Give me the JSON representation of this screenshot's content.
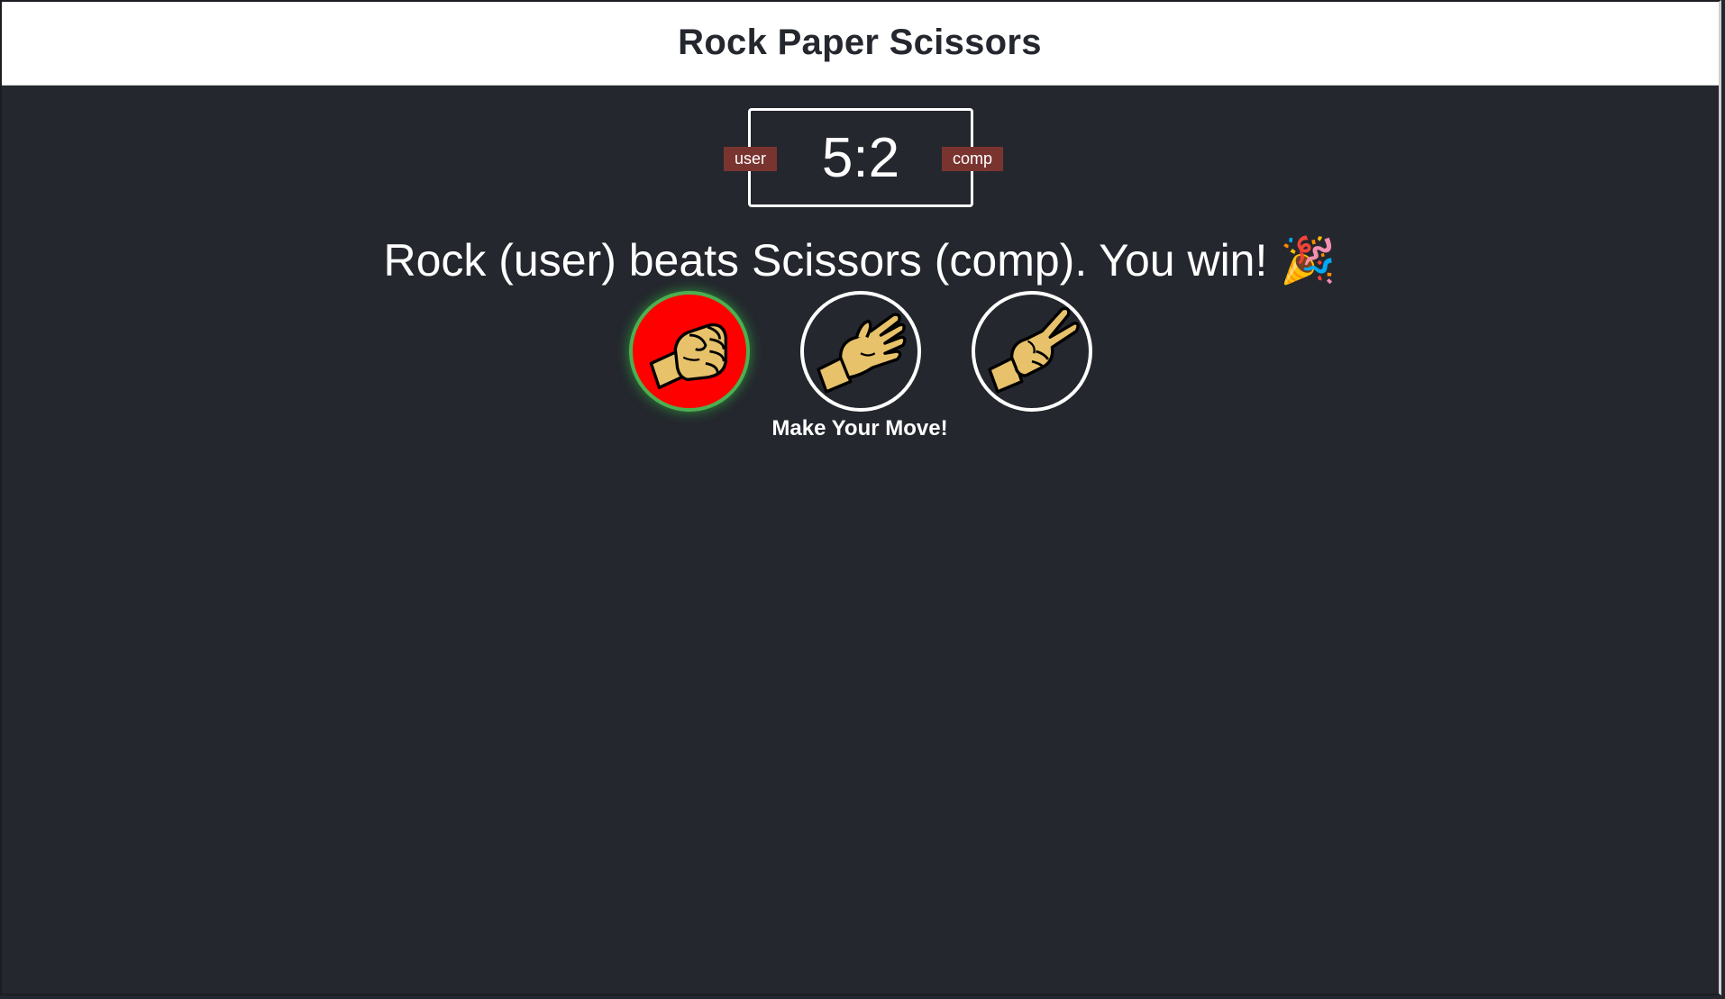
{
  "header": {
    "title": "Rock Paper Scissors"
  },
  "scoreboard": {
    "score": "5:2",
    "user_label": "user",
    "comp_label": "comp"
  },
  "result": {
    "message": "Rock (user) beats Scissors (comp). You win! 🎉"
  },
  "choices": [
    {
      "name": "rock",
      "icon": "rock-fist-icon",
      "selected": true,
      "state": "win"
    },
    {
      "name": "paper",
      "icon": "paper-hand-icon",
      "selected": false
    },
    {
      "name": "scissors",
      "icon": "scissors-hand-icon",
      "selected": false
    }
  ],
  "prompt": "Make Your Move!",
  "colors": {
    "background": "#24272e",
    "header_bg": "#ffffff",
    "badge_bg": "#7a3430",
    "win_fill": "#ff0000",
    "win_ring": "#4caf50"
  }
}
